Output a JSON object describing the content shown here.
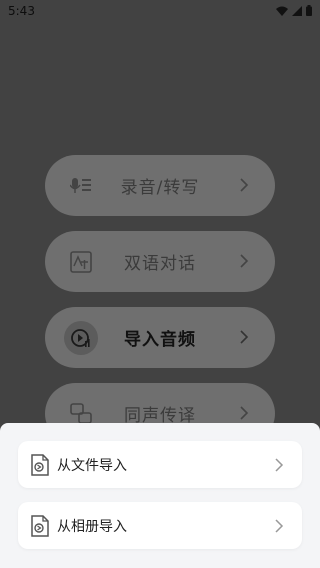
{
  "status_bar": {
    "time": "5:43",
    "icons": [
      "wifi-icon",
      "signal-icon",
      "battery-icon"
    ]
  },
  "menu": {
    "items": [
      {
        "label": "录音/转写",
        "icon": "microphone-text-icon"
      },
      {
        "label": "双语对话",
        "icon": "translate-icon"
      },
      {
        "label": "导入音频",
        "icon": "play-audio-icon",
        "active": true
      },
      {
        "label": "同声传译",
        "icon": "interpret-icon"
      }
    ]
  },
  "sheet": {
    "options": [
      {
        "label": "从文件导入",
        "icon": "file-import-icon"
      },
      {
        "label": "从相册导入",
        "icon": "album-import-icon"
      }
    ]
  },
  "colors": {
    "overlay": "#424242",
    "menu_button": "#6f6f6f",
    "sheet_bg": "#f4f5f7",
    "option_bg": "#ffffff"
  }
}
